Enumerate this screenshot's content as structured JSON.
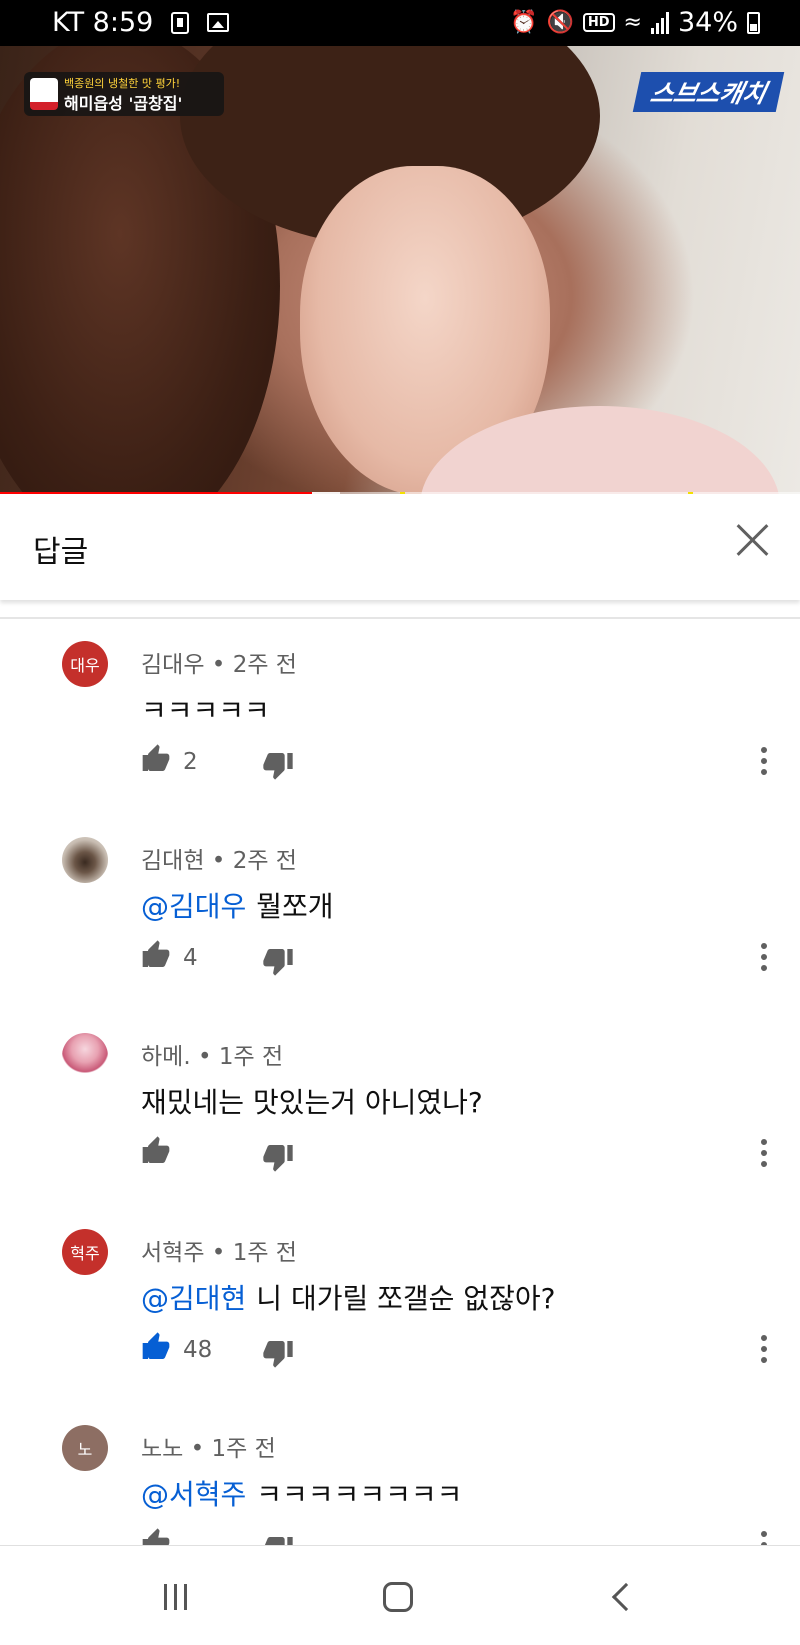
{
  "status_bar": {
    "carrier_time": "KT 8:59",
    "hd": "HD",
    "battery": "34%",
    "battery_level": 0.34
  },
  "video": {
    "badge_line1": "백종원의 냉철한 맛 평가!",
    "badge_line2": "해미읍성 '곱창집'",
    "channel_logo": "스브스캐치",
    "progress_played": 0.39
  },
  "panel": {
    "title": "답글",
    "close_icon": "close-icon"
  },
  "comments": [
    {
      "author": "김대우",
      "time": "2주 전",
      "avatar_text": "대우",
      "avatar_color": "#c4302b",
      "mention": "",
      "text": "ㅋㅋㅋㅋㅋ",
      "likes": "2",
      "liked": false
    },
    {
      "author": "김대현",
      "time": "2주 전",
      "avatar_text": "",
      "avatar_color": "#9d8f82",
      "mention": "@김대우",
      "text": "뭘쪼개",
      "likes": "4",
      "liked": false
    },
    {
      "author": "하메.",
      "time": "1주 전",
      "avatar_text": "",
      "avatar_color": "#e8a2b2",
      "mention": "",
      "text": "재밌네는 맛있는거 아니였나?",
      "likes": "",
      "liked": false
    },
    {
      "author": "서혁주",
      "time": "1주 전",
      "avatar_text": "혁주",
      "avatar_color": "#c4302b",
      "mention": "@김대현",
      "text": "니 대가릴 쪼갤순 없잖아?",
      "likes": "48",
      "liked": true
    },
    {
      "author": "노노",
      "time": "1주 전",
      "avatar_text": "노",
      "avatar_color": "#8d6e63",
      "mention": "@서혁주",
      "text": "ㅋㅋㅋㅋㅋㅋㅋㅋ",
      "likes": "",
      "liked": false
    }
  ],
  "colors": {
    "accent_blue": "#065fd4",
    "youtube_red": "#ff0000",
    "meta_gray": "#606060"
  }
}
